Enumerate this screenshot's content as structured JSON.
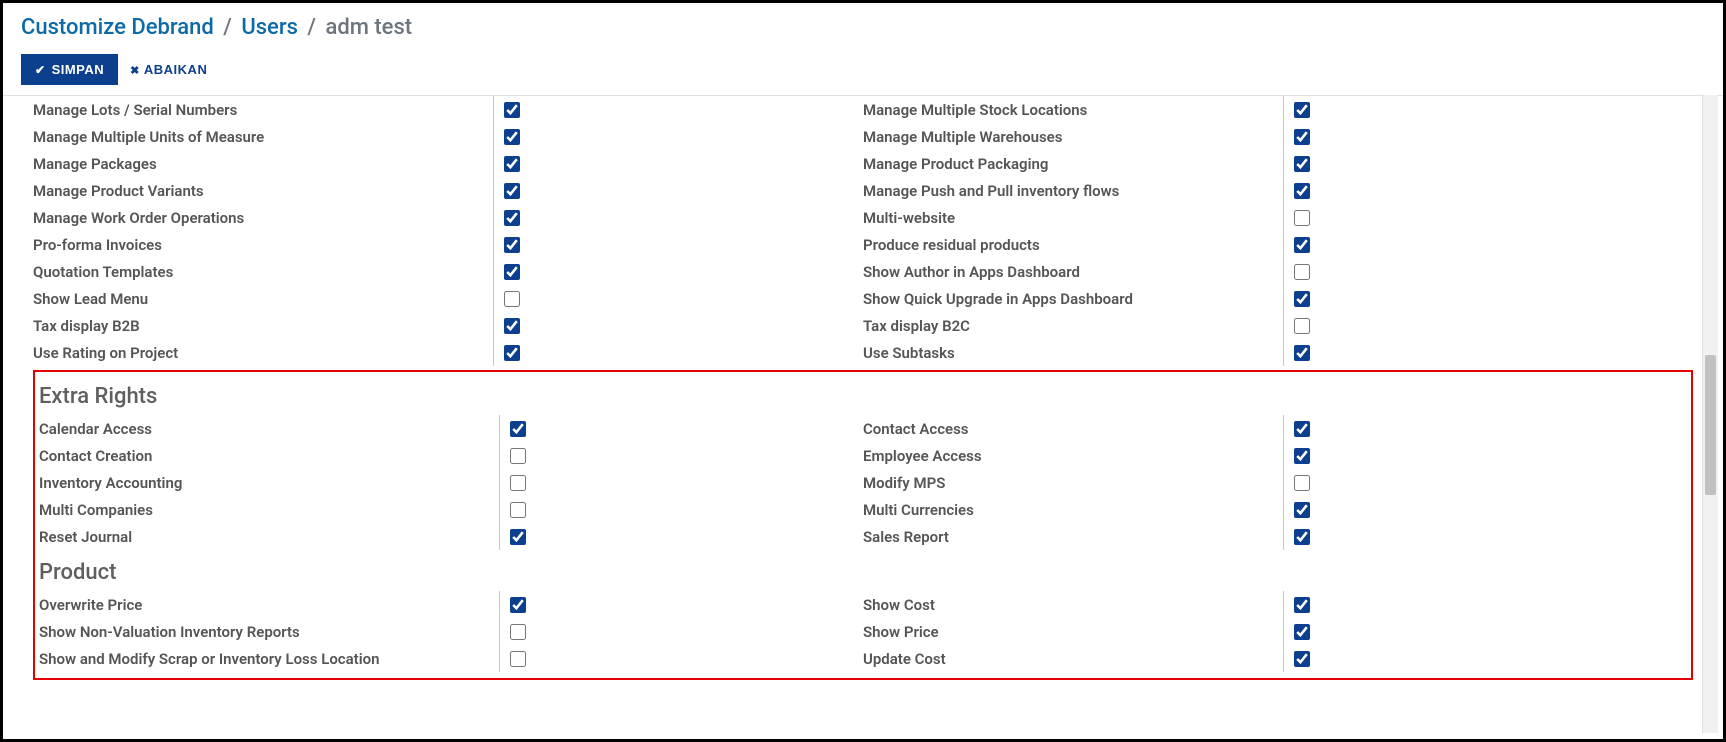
{
  "breadcrumb": {
    "root": "Customize Debrand",
    "parent": "Users",
    "current": "adm test",
    "sep": "/"
  },
  "actions": {
    "save_label": "SIMPAN",
    "discard_label": "ABAIKAN"
  },
  "sections": {
    "top": {
      "left": [
        {
          "label": "Manage Lots / Serial Numbers",
          "checked": true
        },
        {
          "label": "Manage Multiple Units of Measure",
          "checked": true
        },
        {
          "label": "Manage Packages",
          "checked": true
        },
        {
          "label": "Manage Product Variants",
          "checked": true
        },
        {
          "label": "Manage Work Order Operations",
          "checked": true
        },
        {
          "label": "Pro-forma Invoices",
          "checked": true
        },
        {
          "label": "Quotation Templates",
          "checked": true
        },
        {
          "label": "Show Lead Menu",
          "checked": false
        },
        {
          "label": "Tax display B2B",
          "checked": true
        },
        {
          "label": "Use Rating on Project",
          "checked": true
        }
      ],
      "right": [
        {
          "label": "Manage Multiple Stock Locations",
          "checked": true
        },
        {
          "label": "Manage Multiple Warehouses",
          "checked": true
        },
        {
          "label": "Manage Product Packaging",
          "checked": true
        },
        {
          "label": "Manage Push and Pull inventory flows",
          "checked": true
        },
        {
          "label": "Multi-website",
          "checked": false
        },
        {
          "label": "Produce residual products",
          "checked": true
        },
        {
          "label": "Show Author in Apps Dashboard",
          "checked": false
        },
        {
          "label": "Show Quick Upgrade in Apps Dashboard",
          "checked": true
        },
        {
          "label": "Tax display B2C",
          "checked": false
        },
        {
          "label": "Use Subtasks",
          "checked": true
        }
      ]
    },
    "extra_rights": {
      "title": "Extra Rights",
      "left": [
        {
          "label": "Calendar Access",
          "checked": true
        },
        {
          "label": "Contact Creation",
          "checked": false
        },
        {
          "label": "Inventory Accounting",
          "checked": false
        },
        {
          "label": "Multi Companies",
          "checked": false
        },
        {
          "label": "Reset Journal",
          "checked": true
        }
      ],
      "right": [
        {
          "label": "Contact Access",
          "checked": true
        },
        {
          "label": "Employee Access",
          "checked": true
        },
        {
          "label": "Modify MPS",
          "checked": false
        },
        {
          "label": "Multi Currencies",
          "checked": true
        },
        {
          "label": "Sales Report",
          "checked": true
        }
      ]
    },
    "product": {
      "title": "Product",
      "left": [
        {
          "label": "Overwrite Price",
          "checked": true
        },
        {
          "label": "Show Non-Valuation Inventory Reports",
          "checked": false
        },
        {
          "label": "Show and Modify Scrap or Inventory Loss Location",
          "checked": false
        }
      ],
      "right": [
        {
          "label": "Show Cost",
          "checked": true
        },
        {
          "label": "Show Price",
          "checked": true
        },
        {
          "label": "Update Cost",
          "checked": true
        }
      ]
    }
  }
}
